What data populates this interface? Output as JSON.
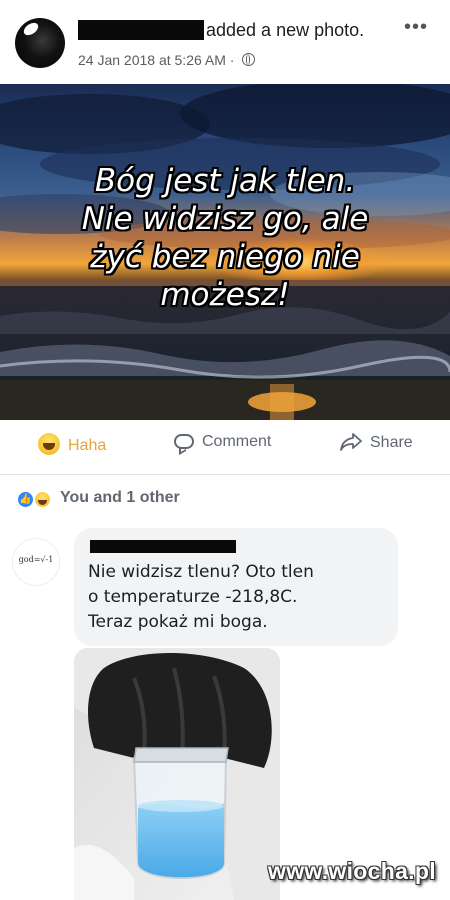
{
  "post": {
    "action_text": "added a new photo.",
    "timestamp": "24 Jan 2018 at 5:26 AM",
    "separator": "·",
    "audience_icon": "globe-icon",
    "more_label": "•••"
  },
  "image_quote": {
    "line1": "Bóg jest jak tlen.",
    "line2": "Nie widzisz go, ale",
    "line3": "żyć bez niego nie",
    "line4": "możesz!"
  },
  "actions": {
    "haha_label": "Haha",
    "comment_label": "Comment",
    "share_label": "Share",
    "haha_color": "#e9a43a"
  },
  "reactions": {
    "summary": "You and 1 other",
    "icons": [
      "like-icon",
      "haha-icon"
    ]
  },
  "comment": {
    "avatar_text": "god=√-1",
    "line1": "Nie widzisz tlenu? Oto tlen",
    "line2": "o temperaturze -218,8C.",
    "line3": "Teraz pokaż mi boga."
  },
  "watermark": "www.wiocha.pl"
}
